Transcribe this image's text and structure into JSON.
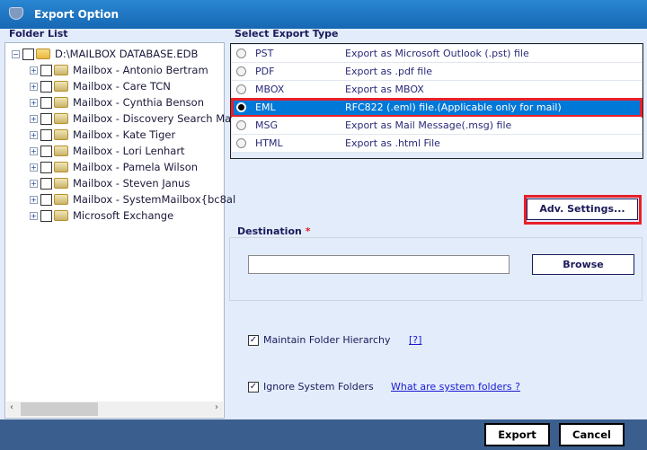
{
  "window": {
    "title": "Export Option"
  },
  "folder_list": {
    "label": "Folder List",
    "root": "D:\\MAILBOX DATABASE.EDB",
    "items": [
      "Mailbox - Antonio Bertram",
      "Mailbox - Care TCN",
      "Mailbox - Cynthia Benson",
      "Mailbox - Discovery Search Mai",
      "Mailbox - Kate Tiger",
      "Mailbox - Lori Lenhart",
      "Mailbox - Pamela Wilson",
      "Mailbox - Steven Janus",
      "Mailbox - SystemMailbox{bc8al",
      "Microsoft Exchange"
    ]
  },
  "export_type": {
    "label": "Select Export Type",
    "selected": "EML",
    "options": [
      {
        "name": "PST",
        "desc": "Export as Microsoft Outlook (.pst) file"
      },
      {
        "name": "PDF",
        "desc": "Export as .pdf file"
      },
      {
        "name": "MBOX",
        "desc": "Export as MBOX"
      },
      {
        "name": "EML",
        "desc": "RFC822 (.eml) file.(Applicable only for mail)"
      },
      {
        "name": "MSG",
        "desc": "Export as Mail Message(.msg) file"
      },
      {
        "name": "HTML",
        "desc": "Export as .html File"
      }
    ]
  },
  "adv_settings_label": "Adv. Settings...",
  "destination": {
    "label": "Destination",
    "required_mark": "*",
    "value": "",
    "browse_label": "Browse"
  },
  "options": {
    "maintain_hierarchy": {
      "label": "Maintain Folder Hierarchy",
      "checked": true,
      "help": "[?]"
    },
    "ignore_system": {
      "label": "Ignore System Folders",
      "checked": true,
      "help": "What are system folders ?"
    }
  },
  "footer": {
    "export_label": "Export",
    "cancel_label": "Cancel"
  }
}
